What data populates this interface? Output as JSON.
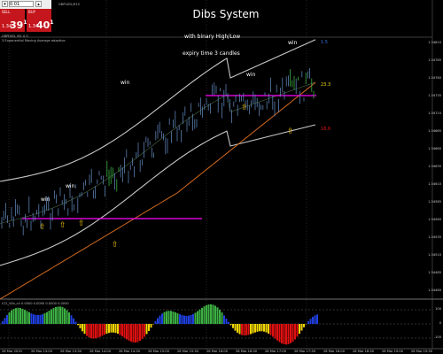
{
  "trade_panel": {
    "sell_label": "SELL",
    "buy_label": "BUY",
    "lot_value": "0.01",
    "sell_price_prefix": "1.34",
    "sell_price_big": "39",
    "sell_price_sup": "1",
    "buy_price_prefix": "1.34",
    "buy_price_big": "40",
    "buy_price_sup": "1"
  },
  "chart_info": {
    "symbol": "GBPUSD,M15",
    "line2": "GBPUSD, M1 0.5",
    "line3": "3 Exponential Moving Average adaptive"
  },
  "chart_title": {
    "title": "Dibs System",
    "line1": "with binary High/Low",
    "line2": "expiry time 3 candles"
  },
  "win_labels": [
    "win",
    "win",
    "win",
    "win",
    "win"
  ],
  "band_labels": {
    "upper": "1.5",
    "middle": "23.3",
    "lower": "18.6"
  },
  "colors": {
    "background": "#000000",
    "bands": "#c8c8c8",
    "ma": "#d2691e",
    "magenta": "#ff00ff",
    "bars": "#5a7fb0",
    "hist_green": "#3cb043",
    "hist_blue": "#1f3fe0",
    "hist_yellow": "#f2d600",
    "hist_red": "#e01010",
    "arrow": "#f2c200"
  },
  "price_axis": [
    "1.34810",
    "1.34785",
    "1.34760",
    "1.34735",
    "1.34710",
    "1.34685",
    "1.34660",
    "1.34635",
    "1.34610",
    "1.34585",
    "1.34560",
    "1.34535",
    "1.34510",
    "1.34485",
    "1.34460"
  ],
  "time_axis": [
    "26 Mar 2019",
    "26 Mar 13:00",
    "26 Mar 13:30",
    "26 Mar 14:00",
    "26 Mar 14:30",
    "26 Mar 15:00",
    "26 Mar 15:30",
    "26 Mar 16:00",
    "26 Mar 16:30",
    "26 Mar 17:00",
    "26 Mar 17:30",
    "26 Mar 18:00",
    "26 Mar 18:30",
    "26 Mar 19:00",
    "26 Mar 19:30"
  ],
  "indicator": {
    "label": "CCI_10b_c4 0.0000 0.0000 0.0000 0.0000",
    "axis": [
      "100",
      "0",
      "-100"
    ]
  }
}
